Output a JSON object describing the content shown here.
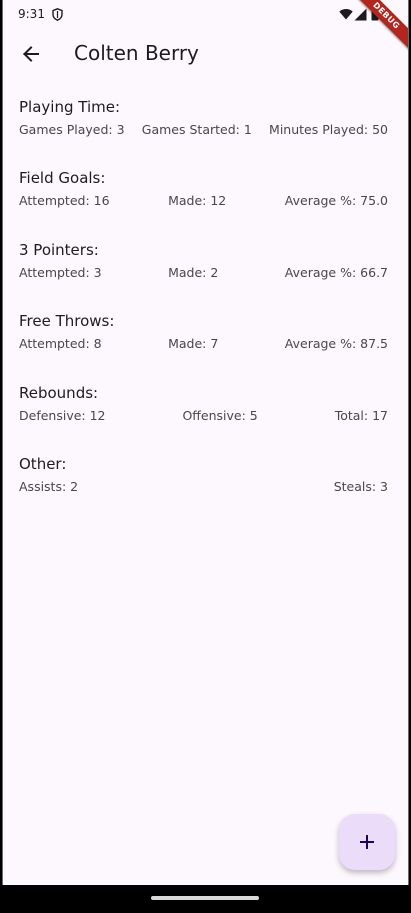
{
  "status_bar": {
    "time": "9:31",
    "debug_label": "DEBUG"
  },
  "app_bar": {
    "title": "Colten Berry"
  },
  "sections": [
    {
      "title": "Playing Time:",
      "stats": [
        "Games Played: 3",
        "Games Started: 1",
        "Minutes Played: 50"
      ]
    },
    {
      "title": "Field Goals:",
      "stats": [
        "Attempted: 16",
        "Made: 12",
        "Average %: 75.0"
      ]
    },
    {
      "title": "3 Pointers:",
      "stats": [
        "Attempted: 3",
        "Made: 2",
        "Average %: 66.7"
      ]
    },
    {
      "title": "Free Throws:",
      "stats": [
        "Attempted: 8",
        "Made: 7",
        "Average %: 87.5"
      ]
    },
    {
      "title": "Rebounds:",
      "stats": [
        "Defensive: 12",
        "Offensive: 5",
        "Total: 17"
      ]
    },
    {
      "title": "Other:",
      "stats": [
        "Assists: 2",
        "Steals: 3"
      ]
    }
  ],
  "fab": {
    "icon": "add-icon",
    "color": "#ebdcfa"
  },
  "colors": {
    "background": "#fdf7fe",
    "text_primary": "#1d1b20",
    "text_secondary": "#49454f",
    "debug_banner": "#b3261e"
  }
}
